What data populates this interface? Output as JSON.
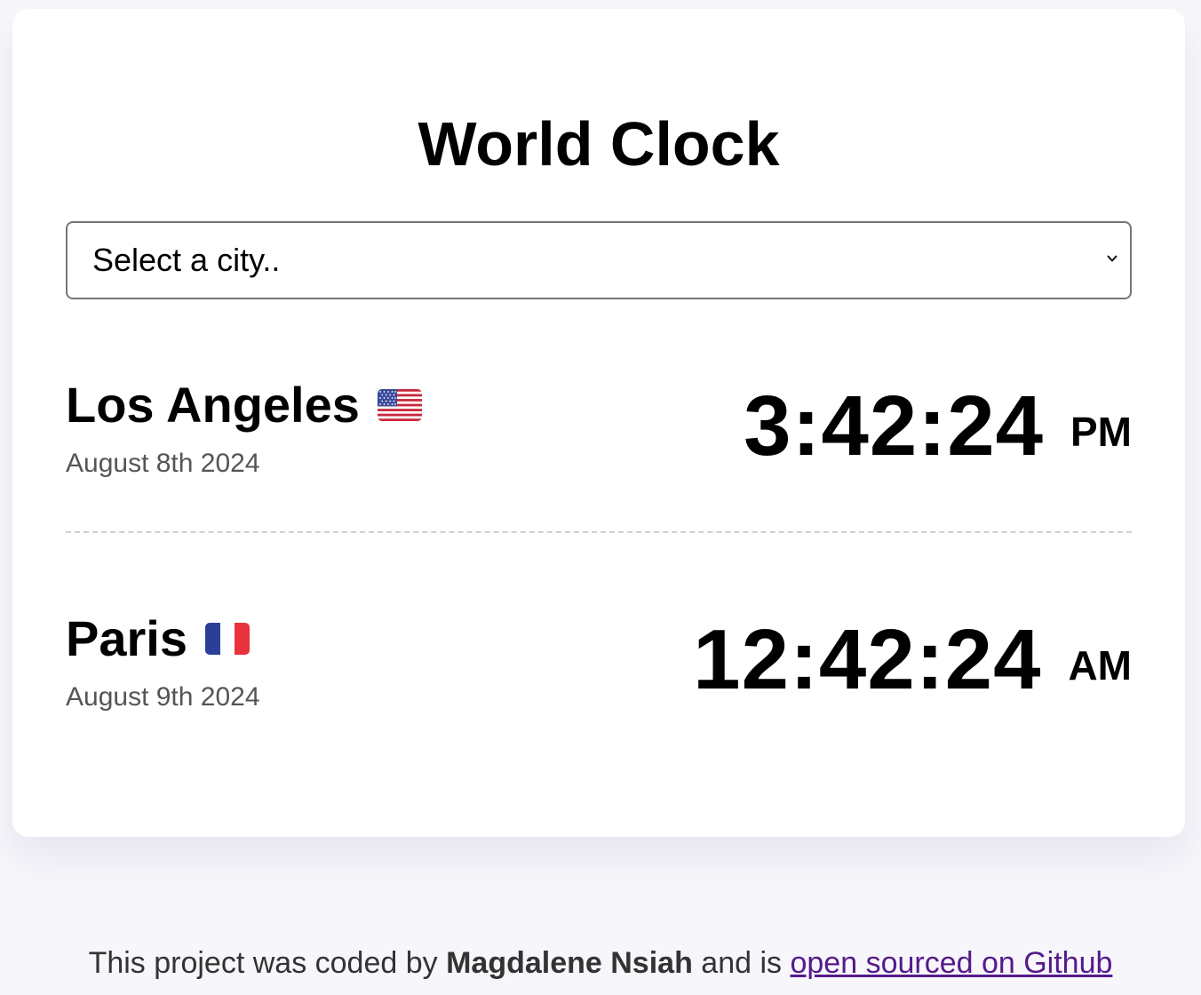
{
  "app": {
    "title": "World Clock"
  },
  "city_select": {
    "selected": "Select a city.."
  },
  "cities": [
    {
      "name": "Los Angeles",
      "flag": "us-flag-icon",
      "date": "August 8th 2024",
      "time": "3:42:24",
      "period": "PM"
    },
    {
      "name": "Paris",
      "flag": "fr-flag-icon",
      "date": "August 9th 2024",
      "time": "12:42:24",
      "period": "AM"
    }
  ],
  "footer": {
    "prefix": "This project was coded by",
    "author": "Magdalene Nsiah",
    "middle": "and is",
    "link_text": "open sourced on Github"
  },
  "colors": {
    "page_background": "#f7f6fb",
    "card_background": "#ffffff",
    "date_text": "#555555",
    "link": "#551a8b"
  }
}
